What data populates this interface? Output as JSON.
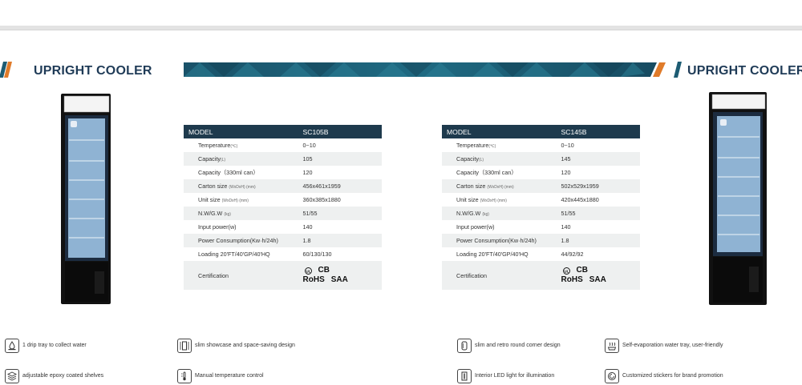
{
  "headings": {
    "left": "UPRIGHT COOLER",
    "right": "UPRIGHT COOLER"
  },
  "colors": {
    "navy": "#1e3a4d",
    "accent": "#e07b2a",
    "banner": "#1d5c73",
    "heading": "#1f3b57"
  },
  "tables": [
    {
      "model_label": "MODEL",
      "model": "SC105B",
      "rows": [
        {
          "label": "Temperature",
          "unit": "(℃)",
          "value": "0~10"
        },
        {
          "label": "Capacity",
          "unit": "(L)",
          "value": "105"
        },
        {
          "label": "Capacity（330ml can）",
          "unit": "",
          "value": "120"
        },
        {
          "label": "Carton size",
          "unit": "(WxDxH) (mm)",
          "value": "456x461x1959"
        },
        {
          "label": "Unit size",
          "unit": "(WxDxH) (mm)",
          "value": "360x385x1880"
        },
        {
          "label": "N.W/G.W",
          "unit": "(kg)",
          "value": "51/55"
        },
        {
          "label": "Input power(w)",
          "unit": "",
          "value": "140"
        },
        {
          "label": "Power Consumption(Kw·h/24h)",
          "unit": "",
          "value": "1.8"
        },
        {
          "label": "Loading 20'FT/40'GP/40'HQ",
          "unit": "",
          "value": "60/130/130"
        }
      ],
      "cert_label": "Certification",
      "cert_marks": [
        "CB",
        "RoHS",
        "SAA"
      ]
    },
    {
      "model_label": "MODEL",
      "model": "SC145B",
      "rows": [
        {
          "label": "Temperature",
          "unit": "(℃)",
          "value": "0~10"
        },
        {
          "label": "Capacity",
          "unit": "(L)",
          "value": "145"
        },
        {
          "label": "Capacity（330ml can）",
          "unit": "",
          "value": "120"
        },
        {
          "label": "Carton size",
          "unit": "(WxDxH) (mm)",
          "value": "502x529x1959"
        },
        {
          "label": "Unit size",
          "unit": "(WxDxH) (mm)",
          "value": "420x445x1880"
        },
        {
          "label": "N.W/G.W",
          "unit": "(kg)",
          "value": "51/55"
        },
        {
          "label": "Input power(w)",
          "unit": "",
          "value": "140"
        },
        {
          "label": "Power Consumption(Kw·h/24h)",
          "unit": "",
          "value": "1.8"
        },
        {
          "label": "Loading 20'FT/40'GP/40'HQ",
          "unit": "",
          "value": "44/92/92"
        }
      ],
      "cert_label": "Certification",
      "cert_marks": [
        "CB",
        "RoHS",
        "SAA"
      ]
    }
  ],
  "features": [
    {
      "icon": "drip-tray-icon",
      "text": "1 drip tray to collect water"
    },
    {
      "icon": "slim-showcase-icon",
      "text": "slim showcase and space-saving design"
    },
    {
      "icon": "round-corner-icon",
      "text": "slim and retro round corner design"
    },
    {
      "icon": "evaporation-tray-icon",
      "text": "Self-evaporation water tray, user-friendly"
    },
    {
      "icon": "shelves-icon",
      "text": "adjustable epoxy coated shelves"
    },
    {
      "icon": "thermostat-icon",
      "text": "Manual temperature control"
    },
    {
      "icon": "led-light-icon",
      "text": "Interior LED light for illumination"
    },
    {
      "icon": "sticker-icon",
      "text": "Customized stickers for brand promotion"
    }
  ]
}
